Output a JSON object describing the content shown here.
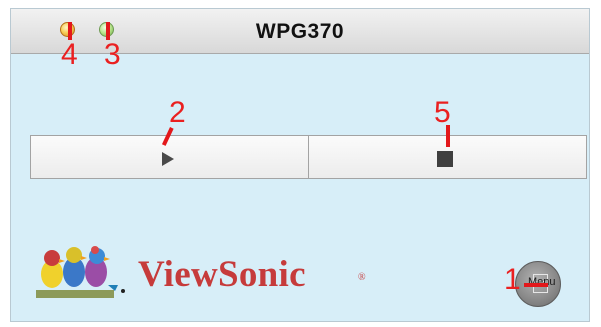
{
  "window": {
    "title": "WPG370"
  },
  "brand": {
    "name": "ViewSonic",
    "mark": "®"
  },
  "menu": {
    "label": "Menu"
  },
  "annotations": {
    "n1": "1",
    "n2": "2",
    "n3": "3",
    "n4": "4",
    "n5": "5"
  },
  "colors": {
    "background": "#d7eef8",
    "brand_red": "#c63b3b",
    "annotation_red": "#e3181b"
  },
  "icons": {
    "play": "play-icon",
    "stop": "stop-icon",
    "menu": "menu-icon"
  }
}
